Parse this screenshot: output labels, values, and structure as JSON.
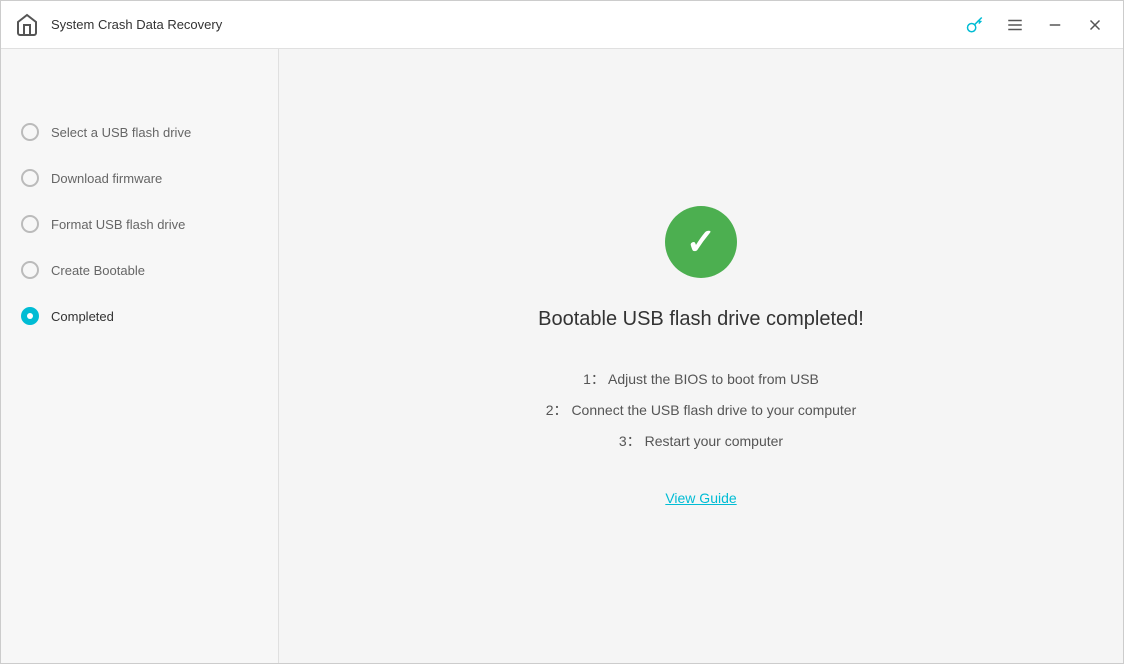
{
  "titleBar": {
    "title": "System Crash Data Recovery",
    "homeIcon": "🏠",
    "keyIcon": "🔑",
    "menuIcon": "☰",
    "minimizeIcon": "—",
    "closeIcon": "✕"
  },
  "sidebar": {
    "items": [
      {
        "id": "select-usb",
        "label": "Select a USB flash drive",
        "state": "default"
      },
      {
        "id": "download-firmware",
        "label": "Download firmware",
        "state": "default"
      },
      {
        "id": "format-usb",
        "label": "Format USB flash drive",
        "state": "default"
      },
      {
        "id": "create-bootable",
        "label": "Create Bootable",
        "state": "default"
      },
      {
        "id": "completed",
        "label": "Completed",
        "state": "active"
      }
    ]
  },
  "mainContent": {
    "successTitle": "Bootable USB flash drive completed!",
    "steps": [
      {
        "number": "1：",
        "text": "Adjust the BIOS to boot from USB"
      },
      {
        "number": "2：",
        "text": "Connect the USB flash drive to your computer"
      },
      {
        "number": "3：",
        "text": "Restart your computer"
      }
    ],
    "viewGuideLabel": "View Guide"
  }
}
